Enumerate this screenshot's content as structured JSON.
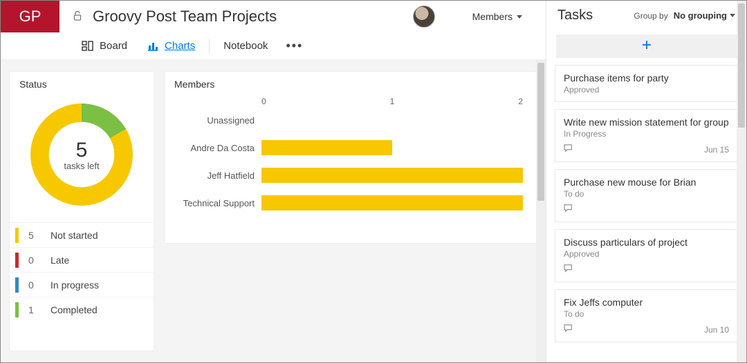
{
  "header": {
    "logo": "GP",
    "privacy_icon": "lock-open-icon",
    "title": "Groovy Post Team Projects",
    "members_label": "Members"
  },
  "tabs": {
    "board": "Board",
    "charts": "Charts",
    "notebook": "Notebook"
  },
  "status_card": {
    "title": "Status",
    "center_number": "5",
    "center_sub": "tasks left",
    "legend": [
      {
        "count": "5",
        "label": "Not started",
        "color": "#f7c800"
      },
      {
        "count": "0",
        "label": "Late",
        "color": "#c72b2b"
      },
      {
        "count": "0",
        "label": "In progress",
        "color": "#2f89c5"
      },
      {
        "count": "1",
        "label": "Completed",
        "color": "#7bbf43"
      }
    ]
  },
  "members_card": {
    "title": "Members",
    "axis": {
      "t0": "0",
      "t1": "1",
      "t2": "2"
    }
  },
  "side": {
    "title": "Tasks",
    "groupby_label": "Group by",
    "groupby_value": "No grouping",
    "tasks": [
      {
        "title": "Purchase items for party",
        "status": "Approved",
        "has_comment": false,
        "date": ""
      },
      {
        "title": "Write new mission statement for group",
        "status": "In Progress",
        "has_comment": true,
        "date": "Jun 15"
      },
      {
        "title": "Purchase new mouse for Brian",
        "status": "To do",
        "has_comment": true,
        "date": ""
      },
      {
        "title": "Discuss particulars of project",
        "status": "Approved",
        "has_comment": true,
        "date": ""
      },
      {
        "title": "Fix Jeffs computer",
        "status": "To do",
        "has_comment": true,
        "date": "Jun 10"
      }
    ]
  },
  "colors": {
    "brand": "#b4152d",
    "accent_blue": "#0078d7",
    "bar_yellow": "#f7c800",
    "donut_green": "#7bbf43"
  },
  "chart_data": [
    {
      "type": "pie",
      "title": "Status",
      "series": [
        {
          "name": "Not started",
          "value": 5,
          "color": "#f7c800"
        },
        {
          "name": "Late",
          "value": 0,
          "color": "#c72b2b"
        },
        {
          "name": "In progress",
          "value": 0,
          "color": "#2f89c5"
        },
        {
          "name": "Completed",
          "value": 1,
          "color": "#7bbf43"
        }
      ],
      "center_label": "5 tasks left"
    },
    {
      "type": "bar",
      "title": "Members",
      "orientation": "horizontal",
      "categories": [
        "Unassigned",
        "Andre Da Costa",
        "Jeff Hatfield",
        "Technical Support"
      ],
      "values": [
        0,
        1,
        2,
        2
      ],
      "xlabel": "",
      "ylabel": "",
      "xlim": [
        0,
        2
      ],
      "bar_color": "#f7c800"
    }
  ]
}
